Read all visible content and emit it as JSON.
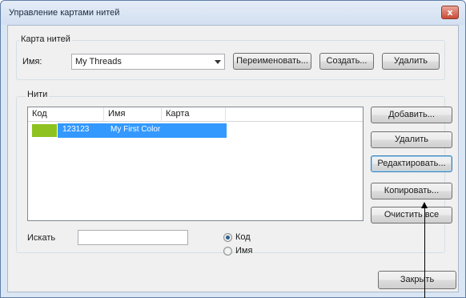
{
  "window": {
    "title": "Управление картами нитей",
    "close_label": "x"
  },
  "thread_map_group": {
    "label": "Карта нитей",
    "name_label": "Имя:",
    "name_value": "My Threads",
    "rename_button": "Переименовать...",
    "create_button": "Создать...",
    "delete_button": "Удалить"
  },
  "threads_group": {
    "label": "Нити",
    "columns": [
      "Код",
      "Имя",
      "Карта"
    ],
    "rows": [
      {
        "color": "#8dc21f",
        "code": "123123",
        "name": "My First Color",
        "map": ""
      }
    ]
  },
  "side_buttons": {
    "add": "Добавить...",
    "delete": "Удалить",
    "edit": "Редактировать...",
    "copy": "Копировать...",
    "clear_all": "Очистить все"
  },
  "search": {
    "label": "Искать",
    "value": "",
    "options": [
      "Код",
      "Имя"
    ],
    "selected": "Код"
  },
  "close_button": "Закрыть"
}
